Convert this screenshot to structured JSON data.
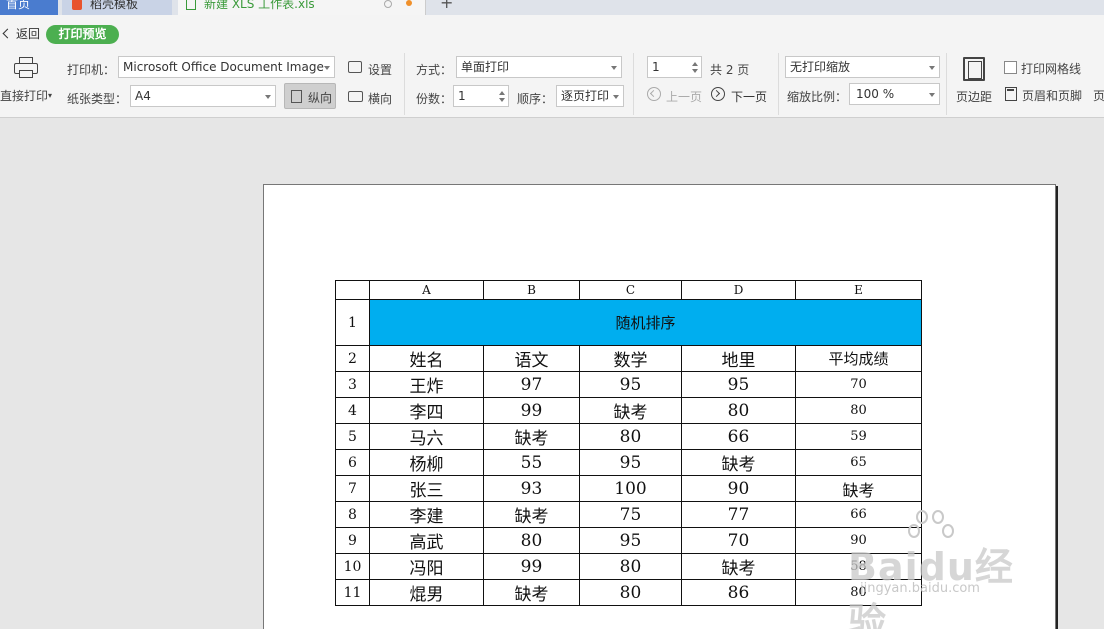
{
  "tabs": {
    "home": "首页",
    "templates": "稻壳模板",
    "file": "新建 XLS 工作表.xls"
  },
  "toolbar": {
    "back": "返回",
    "print_preview": "打印预览",
    "direct_print": "直接打印",
    "printer_label": "打印机：",
    "printer_value": "Microsoft Office Document Image",
    "settings": "设置",
    "paper_label": "纸张类型：",
    "paper_value": "A4",
    "portrait": "纵向",
    "landscape": "横向",
    "mode_label": "方式：",
    "mode_value": "单面打印",
    "copies_label": "份数：",
    "copies_value": "1",
    "order_label": "顺序：",
    "order_value": "逐页打印",
    "page_value": "1",
    "total_pages": "共 2 页",
    "prev_page": "上一页",
    "next_page": "下一页",
    "scale_mode": "无打印缩放",
    "zoom_label": "缩放比例：",
    "zoom_value": "100 %",
    "margins": "页边距",
    "print_gridlines": "打印网格线",
    "header_footer": "页眉和页脚",
    "overflow": "页"
  },
  "sheet": {
    "columns": [
      "A",
      "B",
      "C",
      "D",
      "E"
    ],
    "title": "随机排序",
    "headers": [
      "姓名",
      "语文",
      "数学",
      "地里",
      "平均成绩"
    ],
    "rows": [
      {
        "n": "3",
        "cells": [
          "王炸",
          "97",
          "95",
          "95",
          "70"
        ]
      },
      {
        "n": "4",
        "cells": [
          "李四",
          "99",
          "缺考",
          "80",
          "80"
        ]
      },
      {
        "n": "5",
        "cells": [
          "马六",
          "缺考",
          "80",
          "66",
          "59"
        ]
      },
      {
        "n": "6",
        "cells": [
          "杨柳",
          "55",
          "95",
          "缺考",
          "65"
        ]
      },
      {
        "n": "7",
        "cells": [
          "张三",
          "93",
          "100",
          "90",
          "缺考"
        ]
      },
      {
        "n": "8",
        "cells": [
          "李建",
          "缺考",
          "75",
          "77",
          "66"
        ]
      },
      {
        "n": "9",
        "cells": [
          "高武",
          "80",
          "95",
          "70",
          "90"
        ]
      },
      {
        "n": "10",
        "cells": [
          "冯阳",
          "99",
          "80",
          "缺考",
          "58"
        ]
      },
      {
        "n": "11",
        "cells": [
          "焜男",
          "缺考",
          "80",
          "86",
          "80"
        ]
      }
    ],
    "title_color": "#00aeef"
  },
  "watermark": {
    "brand": "Baidu经验",
    "url": "jingyan.baidu.com"
  }
}
